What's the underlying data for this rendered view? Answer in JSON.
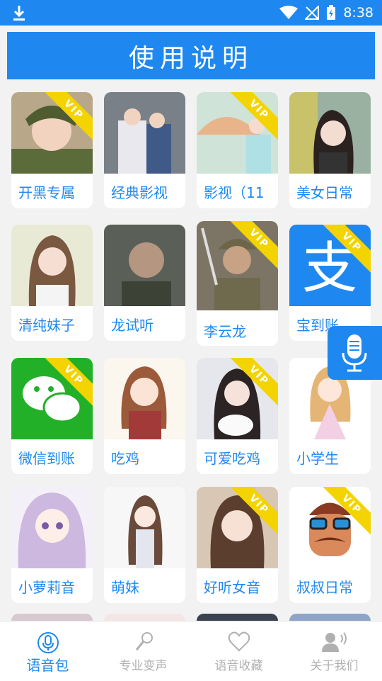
{
  "status_bar": {
    "time": "8:38"
  },
  "page_title": "使用说明",
  "vip_label": "VIP",
  "cards": [
    {
      "label": "开黑专属",
      "vip": true
    },
    {
      "label": "经典影视",
      "vip": false
    },
    {
      "label": "影视（11",
      "vip": true
    },
    {
      "label": "美女日常",
      "vip": false
    },
    {
      "label": "清纯妹子",
      "vip": false
    },
    {
      "label": "龙试听",
      "vip": false
    },
    {
      "label": "李云龙",
      "vip": true
    },
    {
      "label": "宝到账",
      "vip": true
    },
    {
      "label": "微信到账",
      "vip": true
    },
    {
      "label": "吃鸡",
      "vip": false
    },
    {
      "label": "可爱吃鸡",
      "vip": true
    },
    {
      "label": "小学生",
      "vip": false
    },
    {
      "label": "小萝莉音",
      "vip": false
    },
    {
      "label": "萌妹",
      "vip": false
    },
    {
      "label": "好听女音",
      "vip": true
    },
    {
      "label": "叔叔日常",
      "vip": true
    }
  ],
  "tabs": [
    {
      "label": "语音包",
      "active": true,
      "icon": "mic-icon"
    },
    {
      "label": "专业变声",
      "active": false,
      "icon": "microphone-icon"
    },
    {
      "label": "语音收藏",
      "active": false,
      "icon": "heart-icon"
    },
    {
      "label": "关于我们",
      "active": false,
      "icon": "user-speaking-icon"
    }
  ],
  "colors": {
    "accent": "#1e88f0",
    "vip": "#f3d400"
  }
}
